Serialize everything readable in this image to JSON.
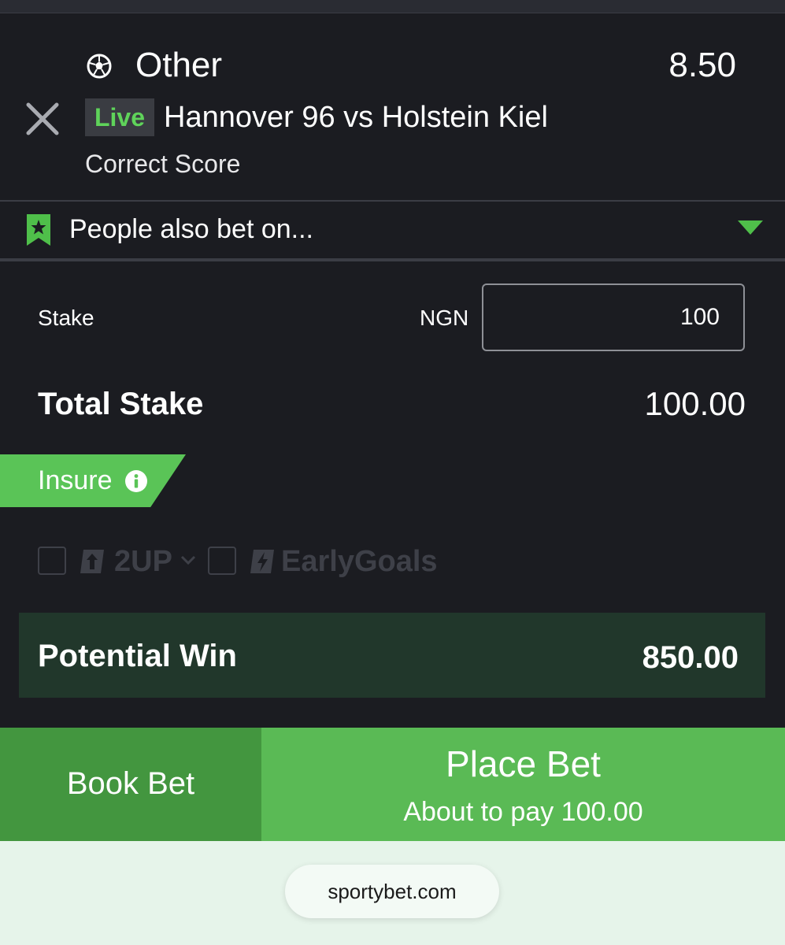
{
  "selection": {
    "outcome": "Other",
    "odds": "8.50",
    "live_badge": "Live",
    "match": "Hannover 96 vs Holstein Kiel",
    "market": "Correct Score"
  },
  "people_also_bet": {
    "label": "People also bet on..."
  },
  "stake": {
    "label": "Stake",
    "currency": "NGN",
    "value": "100"
  },
  "total_stake": {
    "label": "Total Stake",
    "value": "100.00"
  },
  "insure": {
    "label": "Insure"
  },
  "options": [
    {
      "label": "2UP",
      "icon": "arrow-up-icon"
    },
    {
      "label": "EarlyGoals",
      "icon": "lightning-icon"
    }
  ],
  "potential_win": {
    "label": "Potential Win",
    "value": "850.00"
  },
  "buttons": {
    "book_bet": "Book Bet",
    "place_bet": "Place Bet",
    "about_to_pay": "About to pay 100.00"
  },
  "browser": {
    "url": "sportybet.com"
  },
  "colors": {
    "background": "#1b1c21",
    "accent_green": "#5ac457",
    "book_bet_green": "#43963f",
    "potential_win_bg": "#21372b",
    "live_text": "#5fd35a"
  }
}
